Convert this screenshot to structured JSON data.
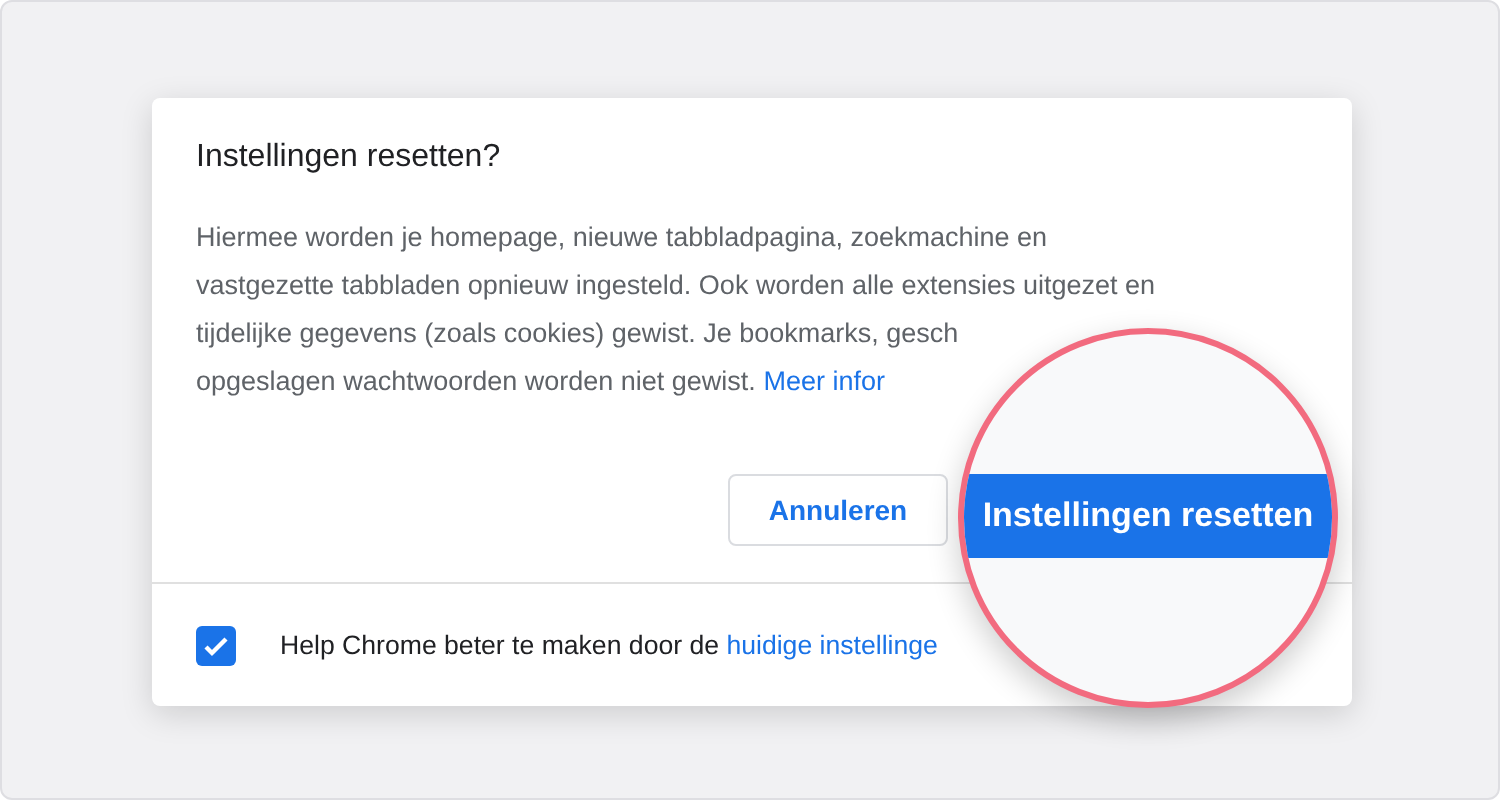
{
  "dialog": {
    "title": "Instellingen resetten?",
    "body_lines": [
      {
        "text": "Hiermee worden je homepage, nieuwe tabbladpagina, zoekmachine en"
      },
      {
        "text": "vastgezette tabbladen opnieuw ingesteld. Ook worden alle extensies uitgezet en"
      },
      {
        "text": "tijdelijke gegevens (zoals cookies) gewist. Je bookmarks, gesch"
      },
      {
        "text": "opgeslagen wachtwoorden worden niet gewist.",
        "link": "Meer infor"
      }
    ],
    "cancel_button": "Annuleren",
    "footer": {
      "checked": true,
      "text": "Help Chrome beter te maken door de",
      "link": "huidige instellinge"
    }
  },
  "magnifier": {
    "button": "Instellingen resetten"
  }
}
